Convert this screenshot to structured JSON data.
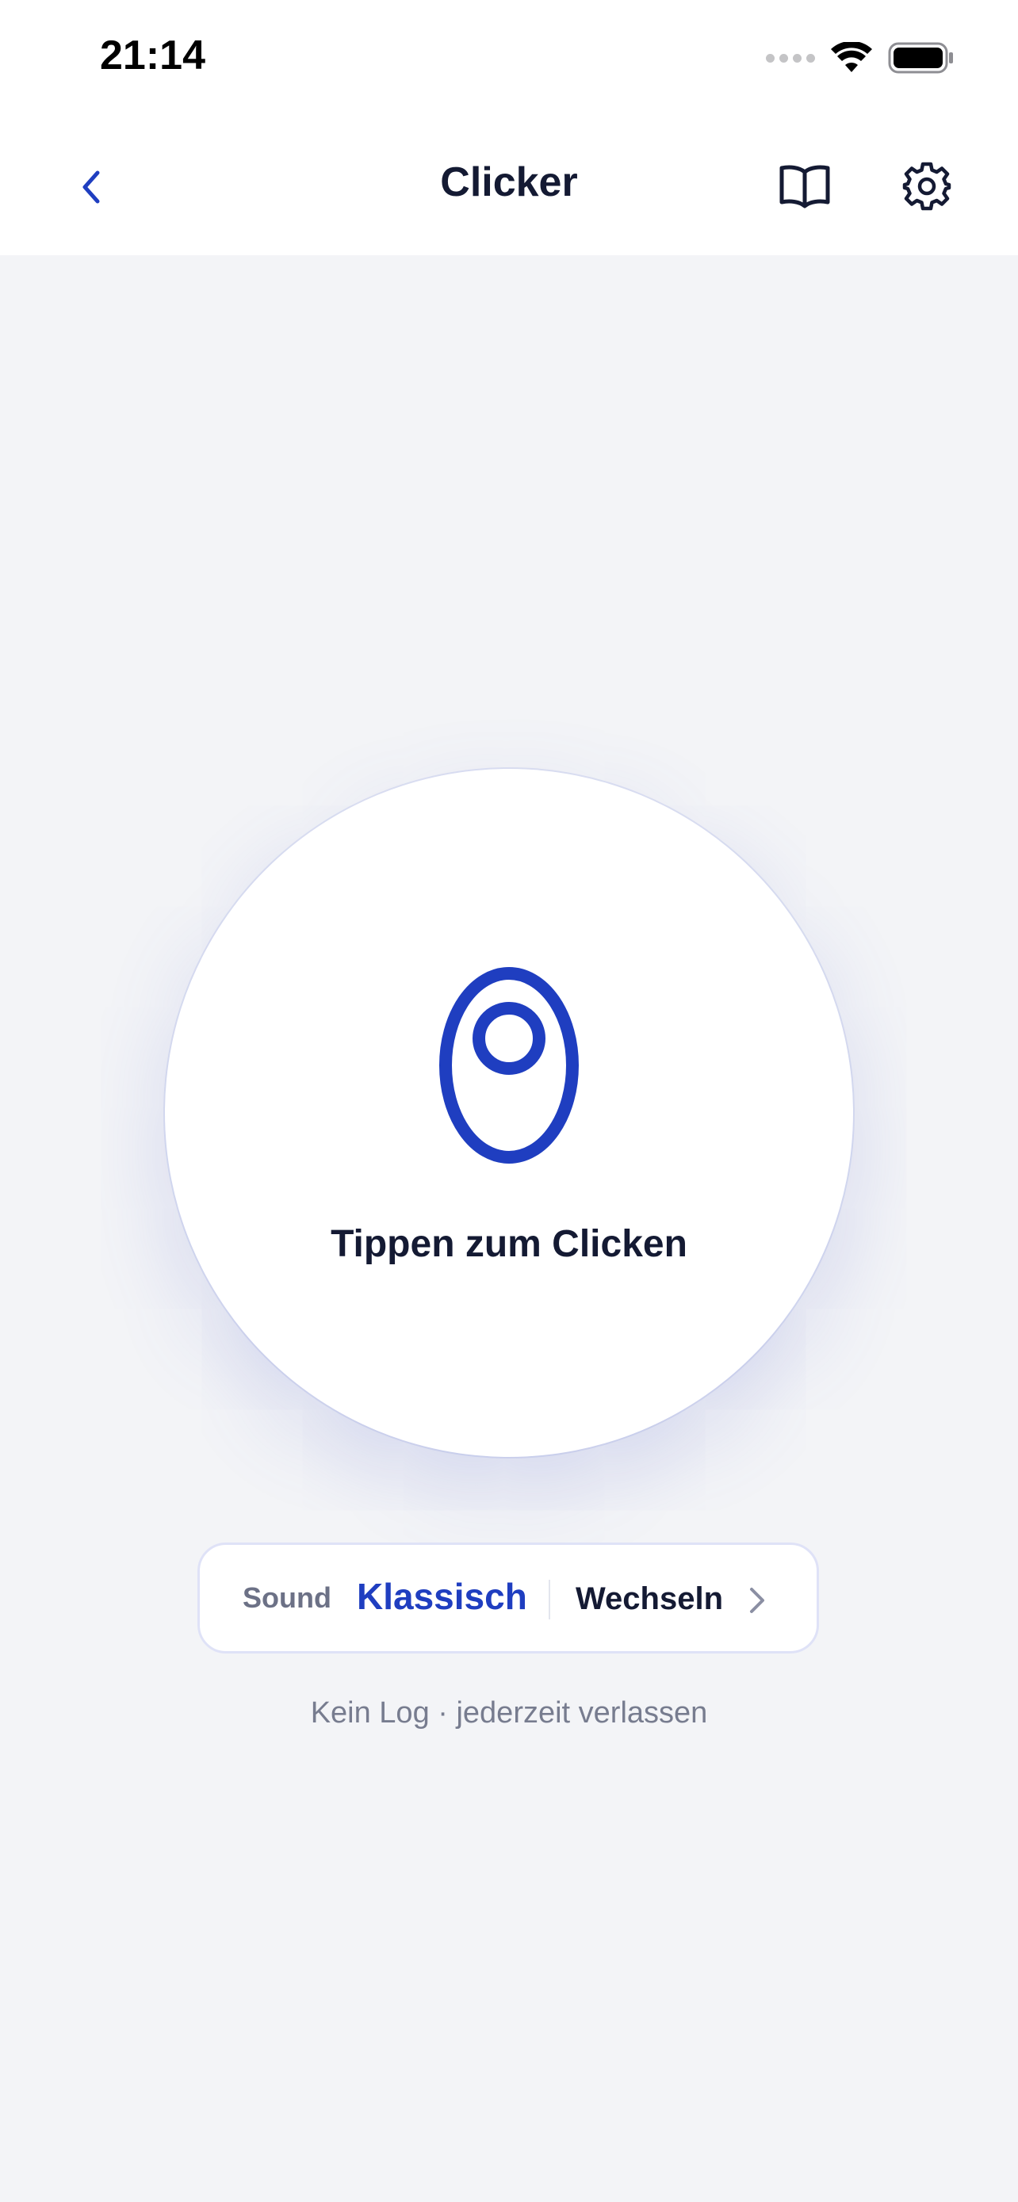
{
  "status_bar": {
    "time": "21:14",
    "icons": [
      "signal-dots-icon",
      "wifi-icon",
      "battery-icon"
    ]
  },
  "nav": {
    "title": "Clicker",
    "back_icon": "chevron-left-icon",
    "guide_icon": "book-open-icon",
    "settings_icon": "gear-icon"
  },
  "clicker": {
    "icon": "clicker-icon",
    "label": "Tippen zum Clicken"
  },
  "sound": {
    "label": "Sound",
    "value": "Klassisch",
    "switch_label": "Wechseln",
    "switch_icon": "chevron-right-icon"
  },
  "footer": {
    "note": "Kein Log · jederzeit verlassen"
  },
  "colors": {
    "accent": "#1f3ec0",
    "title_text": "#141a33",
    "muted_text": "#777c8f",
    "background": "#f3f4f7",
    "surface": "#ffffff"
  }
}
